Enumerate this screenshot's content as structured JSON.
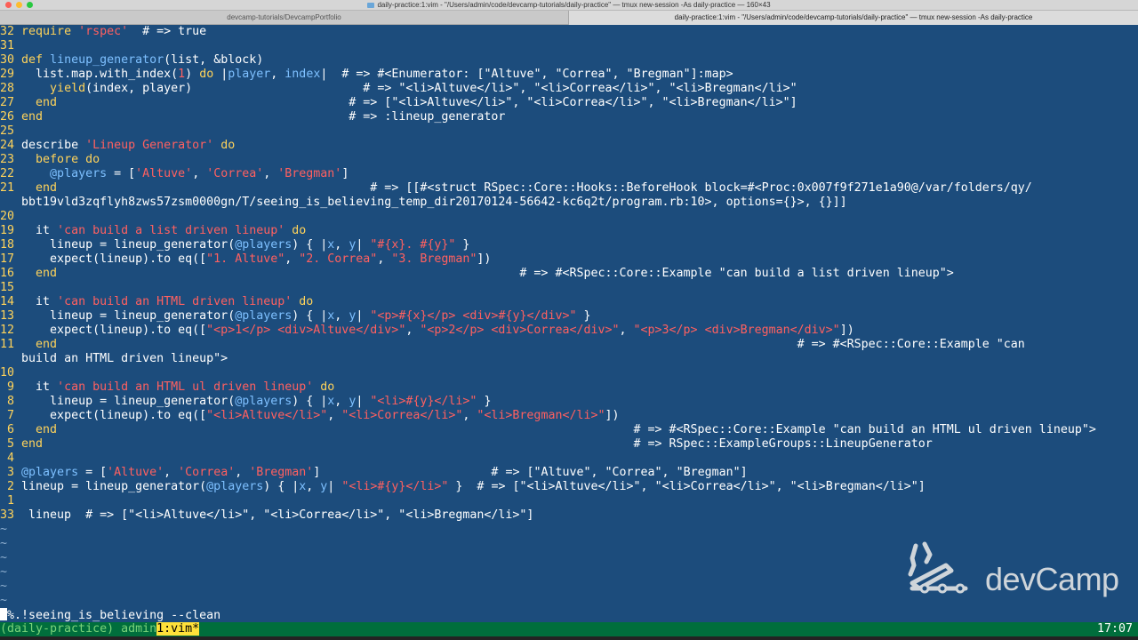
{
  "window": {
    "title": "daily-practice:1:vim - \"/Users/admin/code/devcamp-tutorials/daily-practice\" — tmux new-session -As daily-practice — 160×43",
    "tabs": [
      {
        "label": "devcamp-tutorials/DevcampPortfolio"
      },
      {
        "label": "daily-practice:1:vim - \"/Users/admin/code/devcamp-tutorials/daily-practice\"  — tmux new-session -As daily-practice"
      }
    ]
  },
  "editor": {
    "lines": [
      {
        "n": "32",
        "t": [
          [
            "kw",
            "require "
          ],
          [
            "str",
            "'rspec'"
          ],
          [
            "cmt",
            "  # => true"
          ]
        ]
      },
      {
        "n": "31",
        "t": []
      },
      {
        "n": "30",
        "t": [
          [
            "kw",
            "def "
          ],
          [
            "ivar",
            "lineup_generator"
          ],
          [
            "code",
            "(list, &block)"
          ]
        ]
      },
      {
        "n": "29",
        "t": [
          [
            "code",
            "  list.map.with_index("
          ],
          [
            "str",
            "1"
          ],
          [
            "code",
            ") "
          ],
          [
            "kw",
            "do "
          ],
          [
            "code",
            "|"
          ],
          [
            "ivar",
            "player"
          ],
          [
            "code",
            ", "
          ],
          [
            "ivar",
            "index"
          ],
          [
            "code",
            "|  # => #<Enumerator: [\"Altuve\", \"Correa\", \"Bregman\"]:map>"
          ]
        ]
      },
      {
        "n": "28",
        "t": [
          [
            "kw",
            "    yield"
          ],
          [
            "code",
            "(index, player)                        # => \"<li>Altuve</li>\", \"<li>Correa</li>\", \"<li>Bregman</li>\""
          ]
        ]
      },
      {
        "n": "27",
        "t": [
          [
            "kw",
            "  end"
          ],
          [
            "code",
            "                                         # => [\"<li>Altuve</li>\", \"<li>Correa</li>\", \"<li>Bregman</li>\"]"
          ]
        ]
      },
      {
        "n": "26",
        "t": [
          [
            "kw",
            "end"
          ],
          [
            "code",
            "                                           # => :lineup_generator"
          ]
        ]
      },
      {
        "n": "25",
        "t": []
      },
      {
        "n": "24",
        "t": [
          [
            "code",
            "describe "
          ],
          [
            "str",
            "'Lineup Generator'"
          ],
          [
            "kw",
            " do"
          ]
        ]
      },
      {
        "n": "23",
        "t": [
          [
            "kw",
            "  before do"
          ]
        ]
      },
      {
        "n": "22",
        "t": [
          [
            "ivar",
            "    @players"
          ],
          [
            "code",
            " = ["
          ],
          [
            "str",
            "'Altuve'"
          ],
          [
            "code",
            ", "
          ],
          [
            "str",
            "'Correa'"
          ],
          [
            "code",
            ", "
          ],
          [
            "str",
            "'Bregman'"
          ],
          [
            "code",
            "]"
          ]
        ]
      },
      {
        "n": "21",
        "t": [
          [
            "kw",
            "  end"
          ],
          [
            "code",
            "                                            # => [[#<struct RSpec::Core::Hooks::BeforeHook block=#<Proc:0x007f9f271e1a90@/var/folders/qy/"
          ]
        ]
      },
      {
        "n": "",
        "t": [
          [
            "code",
            "bbt19vld3zqflyh8zws57zsm0000gn/T/seeing_is_believing_temp_dir20170124-56642-kc6q2t/program.rb:10>, options={}>, {}]]"
          ]
        ]
      },
      {
        "n": "20",
        "t": []
      },
      {
        "n": "19",
        "t": [
          [
            "code",
            "  it "
          ],
          [
            "str",
            "'can build a list driven lineup'"
          ],
          [
            "kw",
            " do"
          ]
        ]
      },
      {
        "n": "18",
        "t": [
          [
            "code",
            "    lineup = lineup_generator("
          ],
          [
            "ivar",
            "@players"
          ],
          [
            "code",
            ") { |"
          ],
          [
            "ivar",
            "x"
          ],
          [
            "code",
            ", "
          ],
          [
            "ivar",
            "y"
          ],
          [
            "code",
            "| "
          ],
          [
            "str",
            "\"#{x}. #{y}\""
          ],
          [
            "code",
            " }"
          ]
        ]
      },
      {
        "n": "17",
        "t": [
          [
            "code",
            "    expect(lineup).to eq(["
          ],
          [
            "str",
            "\"1. Altuve\""
          ],
          [
            "code",
            ", "
          ],
          [
            "str",
            "\"2. Correa\""
          ],
          [
            "code",
            ", "
          ],
          [
            "str",
            "\"3. Bregman\""
          ],
          [
            "code",
            "])"
          ]
        ]
      },
      {
        "n": "16",
        "t": [
          [
            "kw",
            "  end"
          ],
          [
            "code",
            "                                                                 # => #<RSpec::Core::Example \"can build a list driven lineup\">"
          ]
        ]
      },
      {
        "n": "15",
        "t": []
      },
      {
        "n": "14",
        "t": [
          [
            "code",
            "  it "
          ],
          [
            "str",
            "'can build an HTML driven lineup'"
          ],
          [
            "kw",
            " do"
          ]
        ]
      },
      {
        "n": "13",
        "t": [
          [
            "code",
            "    lineup = lineup_generator("
          ],
          [
            "ivar",
            "@players"
          ],
          [
            "code",
            ") { |"
          ],
          [
            "ivar",
            "x"
          ],
          [
            "code",
            ", "
          ],
          [
            "ivar",
            "y"
          ],
          [
            "code",
            "| "
          ],
          [
            "str",
            "\"<p>#{x}</p> <div>#{y}</div>\""
          ],
          [
            "code",
            " }"
          ]
        ]
      },
      {
        "n": "12",
        "t": [
          [
            "code",
            "    expect(lineup).to eq(["
          ],
          [
            "str",
            "\"<p>1</p> <div>Altuve</div>\""
          ],
          [
            "code",
            ", "
          ],
          [
            "str",
            "\"<p>2</p> <div>Correa</div>\""
          ],
          [
            "code",
            ", "
          ],
          [
            "str",
            "\"<p>3</p> <div>Bregman</div>\""
          ],
          [
            "code",
            "])"
          ]
        ]
      },
      {
        "n": "11",
        "t": [
          [
            "kw",
            "  end"
          ],
          [
            "code",
            "                                                                                                        # => #<RSpec::Core::Example \"can"
          ]
        ]
      },
      {
        "n": "",
        "t": [
          [
            "code",
            "build an HTML driven lineup\">"
          ]
        ]
      },
      {
        "n": "10",
        "t": []
      },
      {
        "n": "9",
        "t": [
          [
            "code",
            "  it "
          ],
          [
            "str",
            "'can build an HTML ul driven lineup'"
          ],
          [
            "kw",
            " do"
          ]
        ]
      },
      {
        "n": "8",
        "t": [
          [
            "code",
            "    lineup = lineup_generator("
          ],
          [
            "ivar",
            "@players"
          ],
          [
            "code",
            ") { |"
          ],
          [
            "ivar",
            "x"
          ],
          [
            "code",
            ", "
          ],
          [
            "ivar",
            "y"
          ],
          [
            "code",
            "| "
          ],
          [
            "str",
            "\"<li>#{y}</li>\""
          ],
          [
            "code",
            " }"
          ]
        ]
      },
      {
        "n": "7",
        "t": [
          [
            "code",
            "    expect(lineup).to eq(["
          ],
          [
            "str",
            "\"<li>Altuve</li>\""
          ],
          [
            "code",
            ", "
          ],
          [
            "str",
            "\"<li>Correa</li>\""
          ],
          [
            "code",
            ", "
          ],
          [
            "str",
            "\"<li>Bregman</li>\""
          ],
          [
            "code",
            "])"
          ]
        ]
      },
      {
        "n": "6",
        "t": [
          [
            "kw",
            "  end"
          ],
          [
            "code",
            "                                                                                 # => #<RSpec::Core::Example \"can build an HTML ul driven lineup\">"
          ]
        ]
      },
      {
        "n": "5",
        "t": [
          [
            "kw",
            "end"
          ],
          [
            "code",
            "                                                                                   # => RSpec::ExampleGroups::LineupGenerator"
          ]
        ]
      },
      {
        "n": "4",
        "t": []
      },
      {
        "n": "3",
        "t": [
          [
            "ivar",
            "@players"
          ],
          [
            "code",
            " = ["
          ],
          [
            "str",
            "'Altuve'"
          ],
          [
            "code",
            ", "
          ],
          [
            "str",
            "'Correa'"
          ],
          [
            "code",
            ", "
          ],
          [
            "str",
            "'Bregman'"
          ],
          [
            "code",
            "]                        # => [\"Altuve\", \"Correa\", \"Bregman\"]"
          ]
        ]
      },
      {
        "n": "2",
        "t": [
          [
            "code",
            "lineup = lineup_generator("
          ],
          [
            "ivar",
            "@players"
          ],
          [
            "code",
            ") { |"
          ],
          [
            "ivar",
            "x"
          ],
          [
            "code",
            ", "
          ],
          [
            "ivar",
            "y"
          ],
          [
            "code",
            "| "
          ],
          [
            "str",
            "\"<li>#{y}</li>\""
          ],
          [
            "code",
            " }  # => [\"<li>Altuve</li>\", \"<li>Correa</li>\", \"<li>Bregman</li>\"]"
          ]
        ]
      },
      {
        "n": "1",
        "t": []
      },
      {
        "n": "33",
        "cur": true,
        "t": [
          [
            "code",
            "lineup  # => [\"<li>Altuve</li>\", \"<li>Correa</li>\", \"<li>Bregman</li>\"]"
          ]
        ]
      }
    ],
    "tildes": [
      "~",
      "~",
      "~",
      "~",
      "~",
      "~"
    ]
  },
  "command_line": {
    "text": "%.!seeing_is_believing --clean"
  },
  "tmux": {
    "session": "(daily-practice) ",
    "user": "admin",
    "active_window": "1:vim*",
    "time": "17:07"
  },
  "watermark": {
    "brand": "devCamp"
  }
}
